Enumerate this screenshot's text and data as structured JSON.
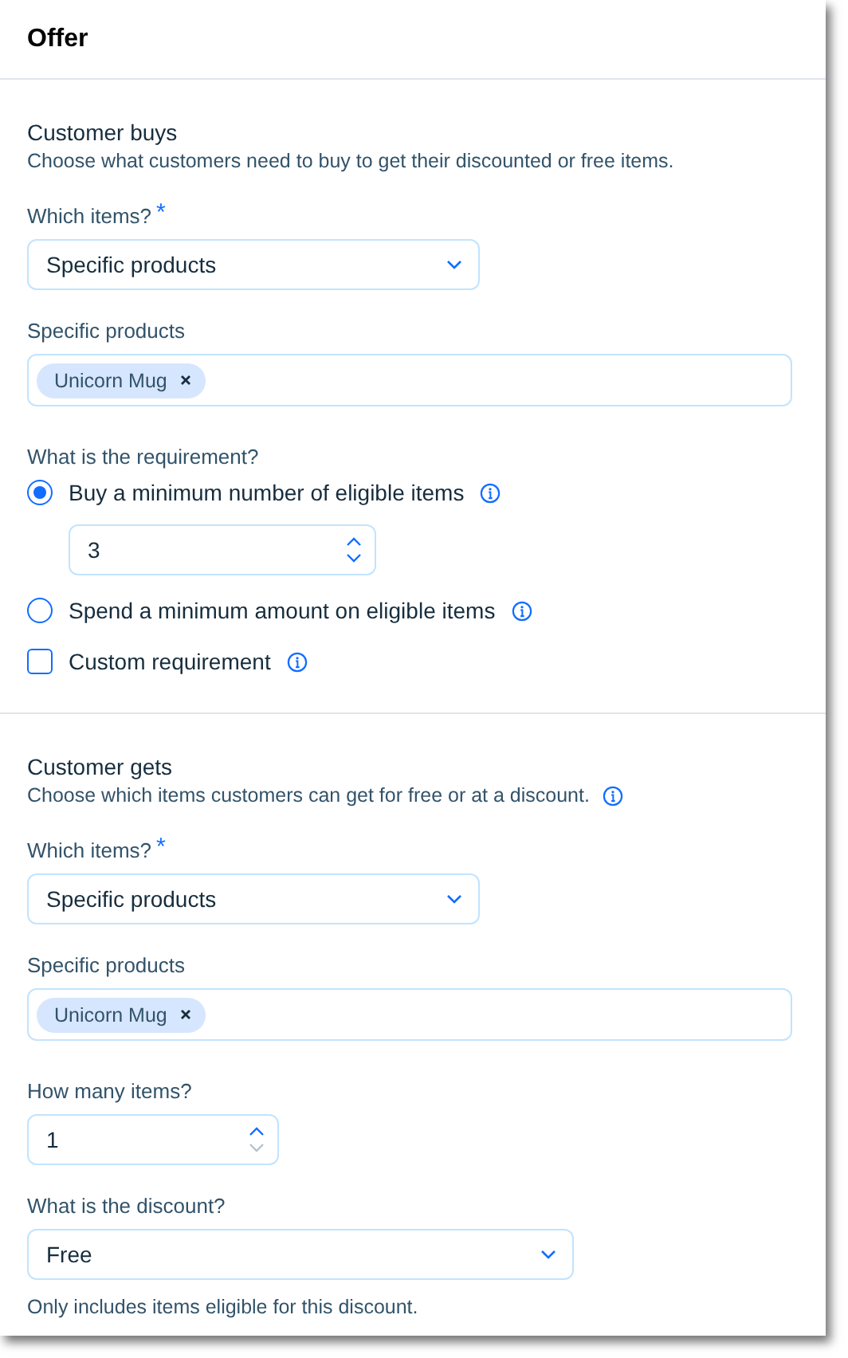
{
  "header": {
    "title": "Offer"
  },
  "sections": [
    {
      "title": "Customer buys",
      "description": "Choose what customers need to buy to get their discounted or free items.",
      "fields": [
        {
          "kind": "select",
          "label": "Which items?",
          "required_mark": "*",
          "value": "Specific products"
        },
        {
          "kind": "tags",
          "label": "Specific products",
          "tags": [
            "Unicorn Mug"
          ]
        },
        {
          "kind": "choices",
          "label": "What is the requirement?",
          "options": [
            {
              "kind": "radio",
              "label": "Buy a minimum number of eligible items",
              "selected": true,
              "info": true,
              "value": "3",
              "min_reached": false
            },
            {
              "kind": "radio",
              "label": "Spend a minimum amount on eligible items",
              "selected": false,
              "info": true
            },
            {
              "kind": "checkbox",
              "label": "Custom requirement",
              "checked": false,
              "info": true
            }
          ]
        }
      ]
    },
    {
      "title": "Customer gets",
      "description": "Choose which items customers can get for free or at a discount.",
      "info": true,
      "fields": [
        {
          "kind": "select",
          "label": "Which items?",
          "required_mark": "*",
          "value": "Specific products"
        },
        {
          "kind": "tags",
          "label": "Specific products",
          "tags": [
            "Unicorn Mug"
          ]
        },
        {
          "kind": "stepper",
          "label": "How many items?",
          "value": "1",
          "min_reached": true
        },
        {
          "kind": "select",
          "label": "What is the discount?",
          "value": "Free",
          "note": "Only includes items eligible for this discount."
        }
      ]
    }
  ]
}
